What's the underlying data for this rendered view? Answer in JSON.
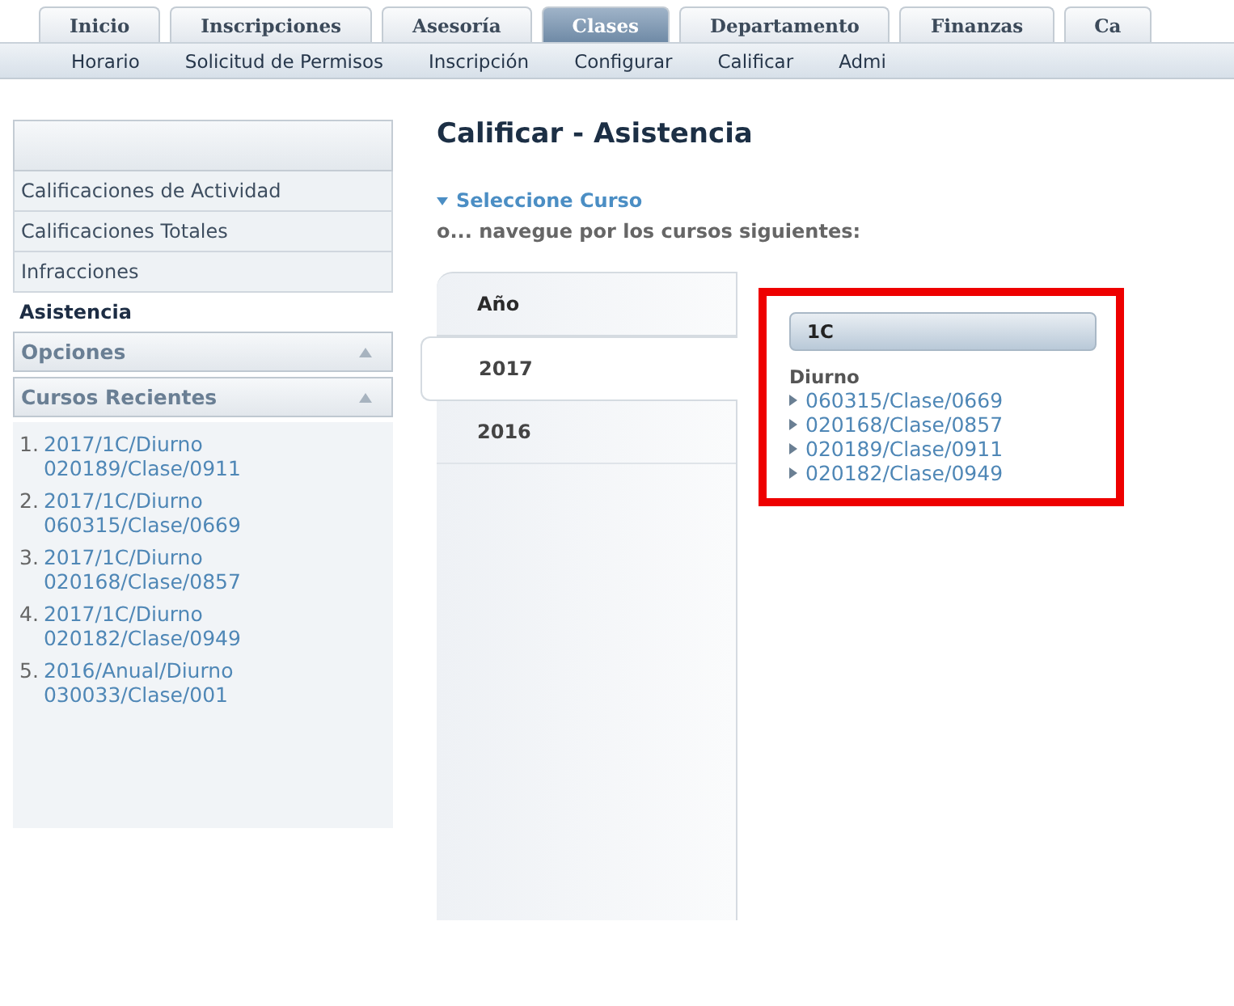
{
  "tabs": [
    {
      "label": "Inicio",
      "selected": false
    },
    {
      "label": "Inscripciones",
      "selected": false
    },
    {
      "label": "Asesoría",
      "selected": false
    },
    {
      "label": "Clases",
      "selected": true
    },
    {
      "label": "Departamento",
      "selected": false
    },
    {
      "label": "Finanzas",
      "selected": false
    },
    {
      "label": "Ca",
      "selected": false
    }
  ],
  "subnav": [
    "Horario",
    "Solicitud de Permisos",
    "Inscripción",
    "Configurar",
    "Calificar",
    "Admi"
  ],
  "sidebar": {
    "items": [
      {
        "label": "Calificaciones de Actividad",
        "selected": false
      },
      {
        "label": "Calificaciones Totales",
        "selected": false
      },
      {
        "label": "Infracciones",
        "selected": false
      },
      {
        "label": "Asistencia",
        "selected": true
      }
    ],
    "sections": [
      {
        "title": "Opciones",
        "expanded": true
      },
      {
        "title": "Cursos Recientes",
        "expanded": true
      }
    ],
    "recent": [
      {
        "number": "1.",
        "line1": "2017/1C/Diurno",
        "line2": "020189/Clase/0911"
      },
      {
        "number": "2.",
        "line1": "2017/1C/Diurno",
        "line2": "060315/Clase/0669"
      },
      {
        "number": "3.",
        "line1": "2017/1C/Diurno",
        "line2": "020168/Clase/0857"
      },
      {
        "number": "4.",
        "line1": "2017/1C/Diurno",
        "line2": "020182/Clase/0949"
      },
      {
        "number": "5.",
        "line1": "2016/Anual/Diurno",
        "line2": "030033/Clase/001"
      }
    ]
  },
  "main": {
    "title": "Calificar - Asistencia",
    "select_link": "Seleccione Curso",
    "subtitle": "o... navegue por los cursos siguientes:",
    "year_header": "Año",
    "years": [
      {
        "label": "2017",
        "selected": true
      },
      {
        "label": "2016",
        "selected": false
      }
    ],
    "group": {
      "title": "1C",
      "shift": "Diurno",
      "courses": [
        "060315/Clase/0669",
        "020168/Clase/0857",
        "020189/Clase/0911",
        "020182/Clase/0949"
      ]
    }
  }
}
